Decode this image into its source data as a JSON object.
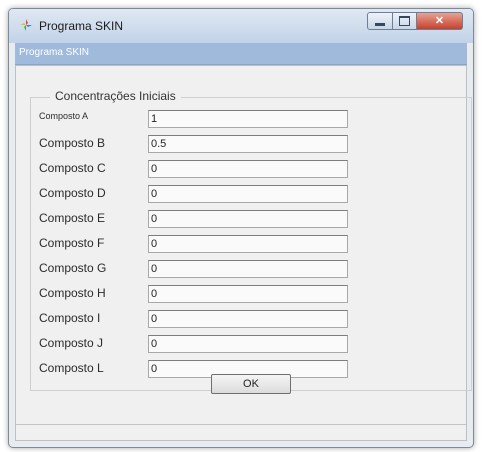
{
  "window": {
    "title": "Programa SKIN",
    "subtitle": "Programa SKIN"
  },
  "group": {
    "title": "Concentrações Iniciais"
  },
  "fields": [
    {
      "label": "Composto A",
      "value": "1"
    },
    {
      "label": "Composto B",
      "value": "0.5"
    },
    {
      "label": "Composto C",
      "value": "0"
    },
    {
      "label": "Composto D",
      "value": "0"
    },
    {
      "label": "Composto E",
      "value": "0"
    },
    {
      "label": "Composto F",
      "value": "0"
    },
    {
      "label": "Composto G",
      "value": "0"
    },
    {
      "label": "Composto H",
      "value": "0"
    },
    {
      "label": "Composto I",
      "value": "0"
    },
    {
      "label": "Composto J",
      "value": "0"
    },
    {
      "label": "Composto L",
      "value": "0"
    }
  ],
  "ok_button": {
    "label": "OK"
  },
  "icons": {
    "app": "app-logo-icon",
    "minimize": "minimize-icon",
    "maximize": "maximize-icon",
    "close": "close-icon"
  },
  "colors": {
    "titlebar": "#c2d3e7",
    "subbar": "#9fbadb",
    "close_button": "#c6402c",
    "client_background": "#f0f0f0"
  }
}
